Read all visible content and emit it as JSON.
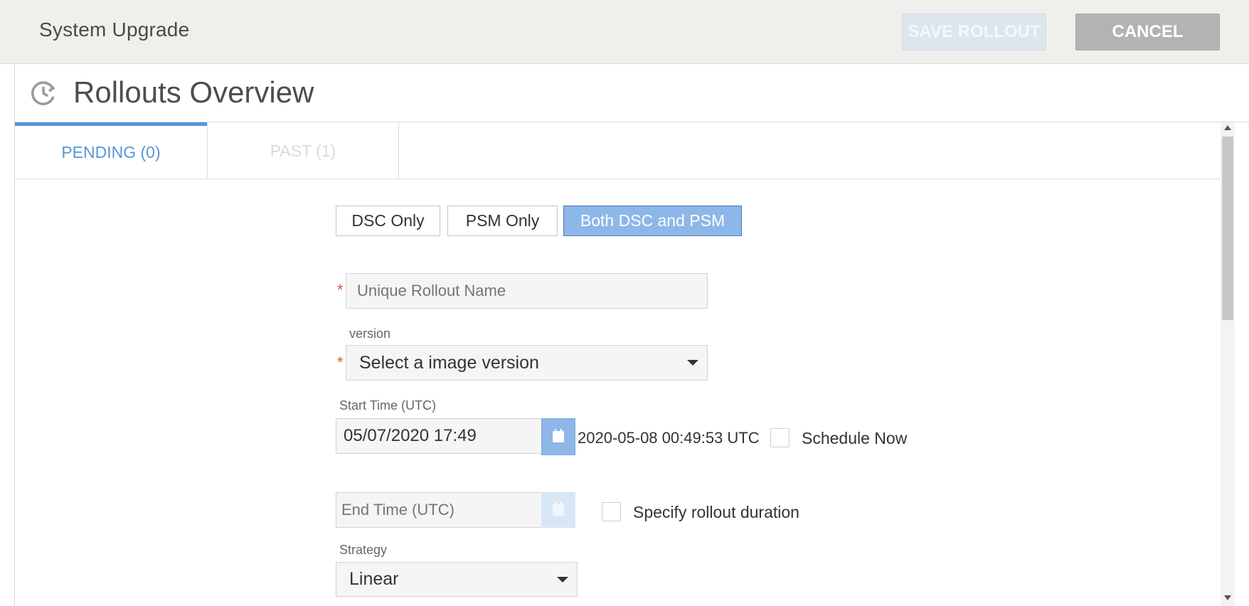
{
  "header": {
    "title": "System Upgrade",
    "save_label": "SAVE ROLLOUT",
    "cancel_label": "CANCEL"
  },
  "panel": {
    "title": "Rollouts Overview",
    "icon": "history-clock-icon"
  },
  "tabs": [
    {
      "label": "PENDING (0)",
      "active": true
    },
    {
      "label": "PAST (1)",
      "active": false
    }
  ],
  "target_options": [
    {
      "label": "DSC Only",
      "selected": false
    },
    {
      "label": "PSM Only",
      "selected": false
    },
    {
      "label": "Both DSC and PSM",
      "selected": true
    }
  ],
  "form": {
    "required_mark": "*",
    "rollout_name": {
      "value": "",
      "placeholder": "Unique Rollout Name"
    },
    "version": {
      "label": "version",
      "value": "Select a image version"
    },
    "start_time": {
      "label": "Start Time (UTC)",
      "value": "05/07/2020 17:49",
      "utc_display": "2020-05-08 00:49:53 UTC"
    },
    "schedule_now": {
      "label": "Schedule Now",
      "checked": false
    },
    "end_time": {
      "placeholder": "End Time (UTC)",
      "disabled": true
    },
    "specify_duration": {
      "label": "Specify rollout duration",
      "checked": false
    },
    "strategy": {
      "label": "Strategy",
      "value": "Linear"
    }
  },
  "colors": {
    "accent": "#5b95d9",
    "selected_button": "#8db7e8",
    "required": "#e0533c",
    "header_bg": "#f1efec"
  }
}
